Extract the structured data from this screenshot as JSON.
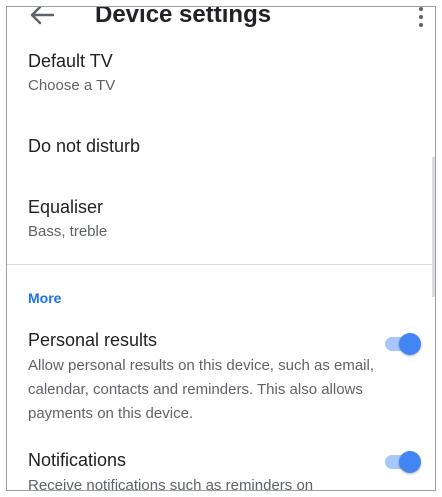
{
  "header": {
    "title": "Device settings",
    "back_icon": "arrow-left-icon",
    "more_icon": "more-vert-icon"
  },
  "items": [
    {
      "title": "Default TV",
      "subtitle": "Choose a TV"
    },
    {
      "title": "Do not disturb",
      "subtitle": ""
    },
    {
      "title": "Equaliser",
      "subtitle": "Bass, treble"
    }
  ],
  "section": {
    "label": "More"
  },
  "settings": [
    {
      "title": "Personal results",
      "description": "Allow personal results on this device, such as email, calendar, contacts and reminders. This also allows payments on this device.",
      "enabled": true
    },
    {
      "title": "Notifications",
      "description": "Receive notifications such as reminders on",
      "enabled": true
    }
  ],
  "colors": {
    "accent": "#1a73e8",
    "toggle_thumb": "#4285f4",
    "toggle_track": "#a8c7fa"
  }
}
